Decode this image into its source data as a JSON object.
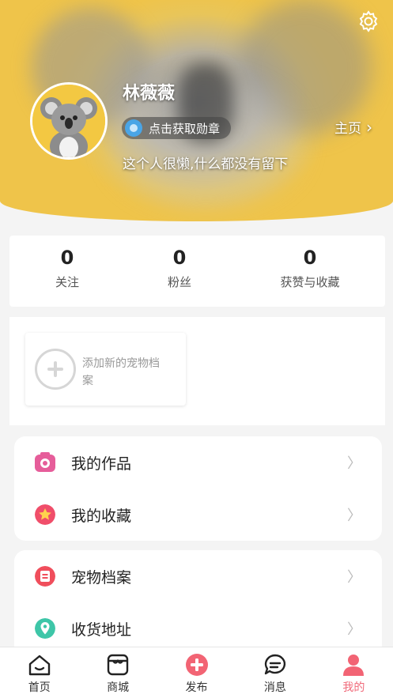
{
  "profile": {
    "username": "林薇薇",
    "medal_label": "点击获取勋章",
    "bio": "这个人很懒,什么都没有留下",
    "homepage_label": "主页"
  },
  "stats": [
    {
      "value": "0",
      "label": "关注"
    },
    {
      "value": "0",
      "label": "粉丝"
    },
    {
      "value": "0",
      "label": "获赞与收藏"
    }
  ],
  "pets": {
    "add_label": "添加新的宠物档案"
  },
  "menu_group_1": [
    {
      "label": "我的作品",
      "icon": "camera-icon",
      "color": "#e65d9a"
    },
    {
      "label": "我的收藏",
      "icon": "star-icon",
      "color": "#f04e6a"
    }
  ],
  "menu_group_2": [
    {
      "label": "宠物档案",
      "icon": "document-icon",
      "color": "#f04e5c"
    },
    {
      "label": "收货地址",
      "icon": "location-icon",
      "color": "#3ec6a8"
    }
  ],
  "tabbar": [
    {
      "label": "首页",
      "icon": "home-icon"
    },
    {
      "label": "商城",
      "icon": "store-icon"
    },
    {
      "label": "发布",
      "icon": "publish-icon"
    },
    {
      "label": "消息",
      "icon": "message-icon"
    },
    {
      "label": "我的",
      "icon": "profile-icon",
      "active": true
    }
  ],
  "colors": {
    "accent": "#f06a7a",
    "header_yellow": "#efc44a"
  }
}
